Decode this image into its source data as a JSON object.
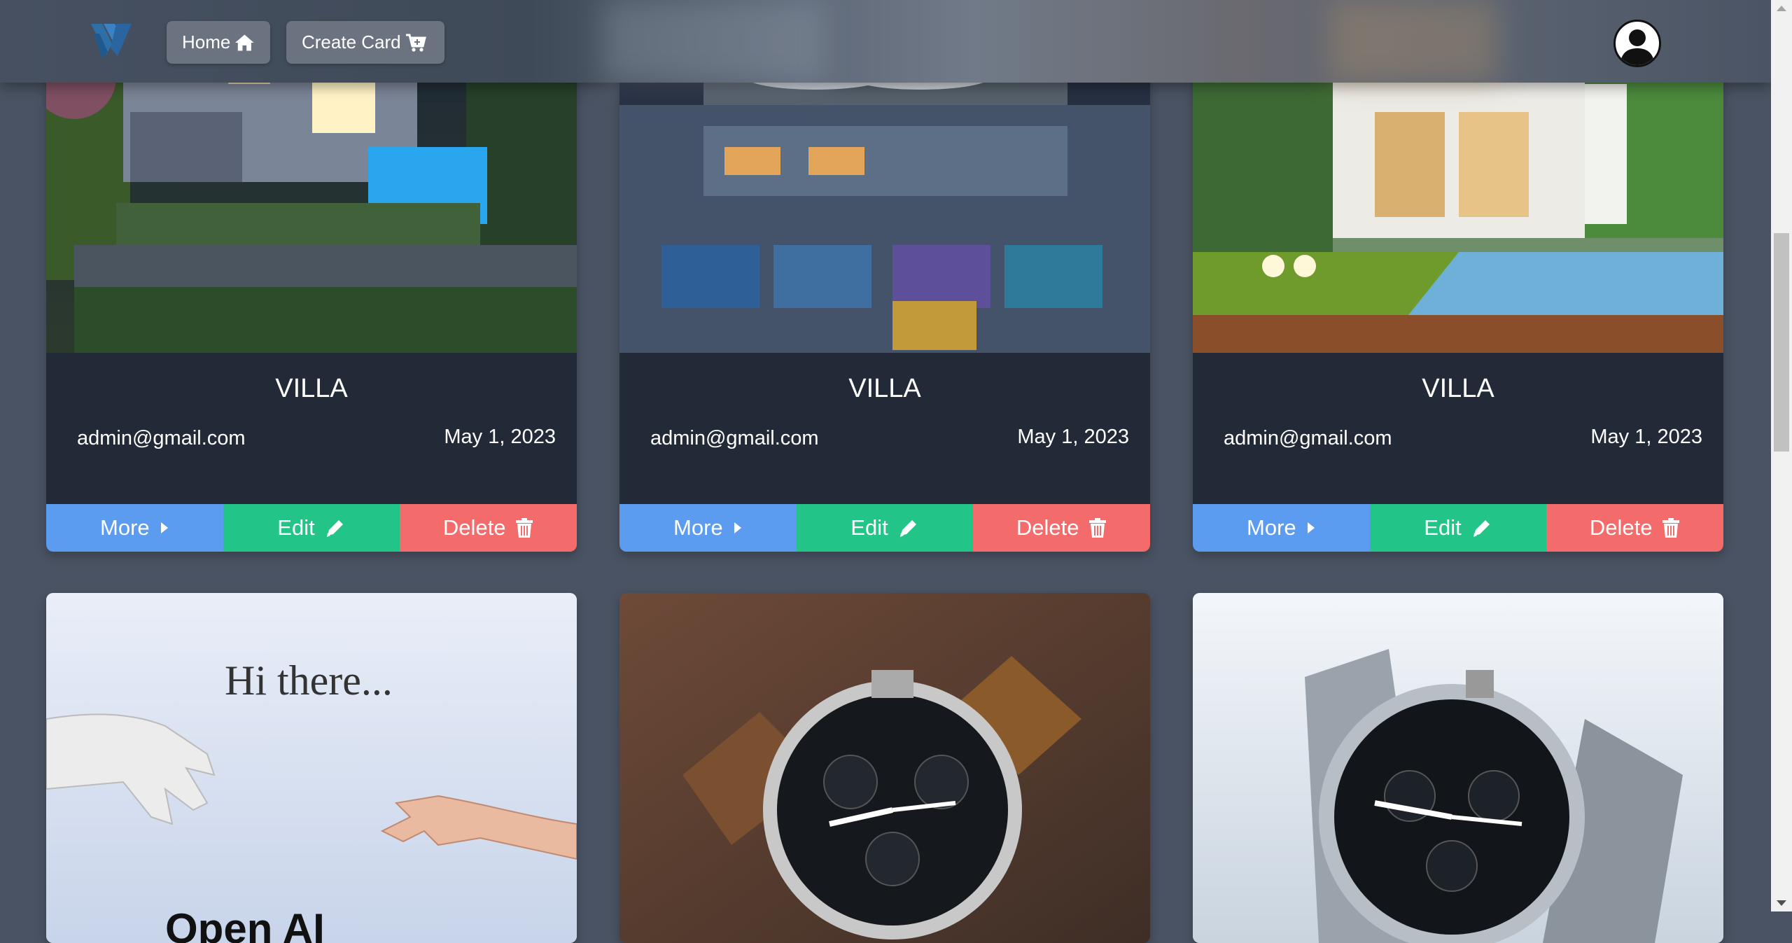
{
  "nav": {
    "home_label": "Home",
    "create_label": "Create Card"
  },
  "colors": {
    "page_bg": "#4a5363",
    "card_bg": "#222a38",
    "more": "#5b9bf0",
    "edit": "#22c488",
    "delete": "#f46b6b"
  },
  "cards": [
    {
      "title": "VILLA",
      "email": "admin@gmail.com",
      "date": "May 1, 2023",
      "more": "More",
      "edit": "Edit",
      "delete": "Delete"
    },
    {
      "title": "VILLA",
      "email": "admin@gmail.com",
      "date": "May 1, 2023",
      "more": "More",
      "edit": "Edit",
      "delete": "Delete"
    },
    {
      "title": "VILLA",
      "email": "admin@gmail.com",
      "date": "May 1, 2023",
      "more": "More",
      "edit": "Edit",
      "delete": "Delete"
    }
  ],
  "bottom_cards": [
    {
      "image_text": "Hi there...",
      "image_caption": "Open AI"
    },
    {
      "image_text": ""
    },
    {
      "image_text": ""
    }
  ],
  "icons": {
    "home": "home-icon",
    "cart": "cart-icon",
    "more": "caret-right-icon",
    "edit": "pencil-icon",
    "delete": "trash-icon",
    "avatar": "user-icon"
  }
}
